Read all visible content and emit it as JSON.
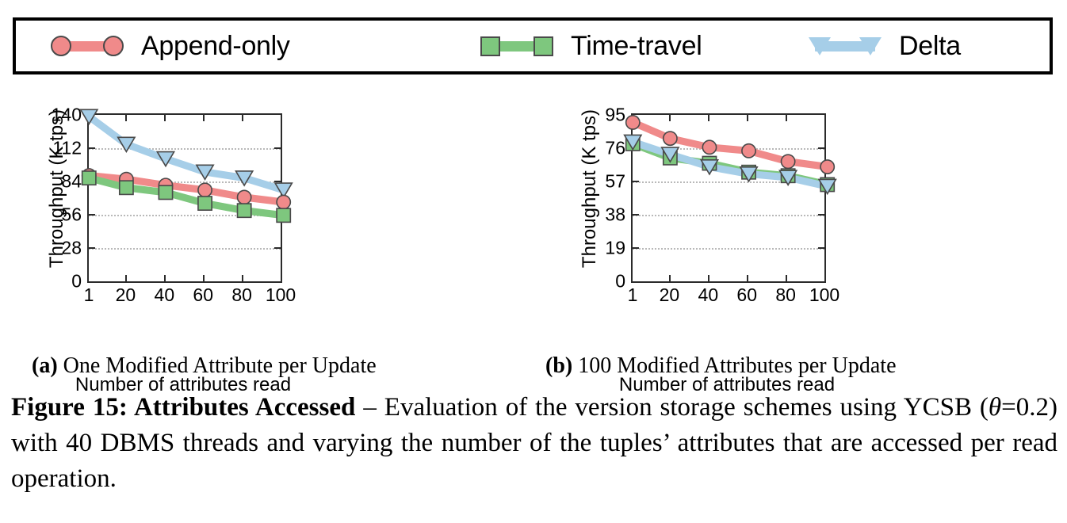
{
  "legend": {
    "entries": [
      {
        "label": "Append-only",
        "marker": "circle",
        "color": "#f08a8a",
        "icon": "circle-marker-icon"
      },
      {
        "label": "Time-travel",
        "marker": "square",
        "color": "#7ec77e",
        "icon": "square-marker-icon"
      },
      {
        "label": "Delta",
        "marker": "triangle-down",
        "color": "#a6cee8",
        "icon": "triangle-down-marker-icon"
      }
    ]
  },
  "subcaptions": {
    "a_tag": "(a)",
    "a_text": " One Modified Attribute per Update",
    "b_tag": "(b)",
    "b_text": " 100 Modified Attributes per Update"
  },
  "caption": {
    "head": "Figure 15:  Attributes Accessed",
    "dash": " – Evaluation of the version storage schemes using YCSB (",
    "theta": "θ",
    "theta_val": "=0.2) with 40 DBMS threads and varying the number of the tuples’ attributes that are accessed per read operation."
  },
  "chart_data": [
    {
      "type": "line",
      "panel": "a",
      "title": "(a) One Modified Attribute per Update",
      "xlabel": "Number of attributes read",
      "ylabel": "Throughput (K tps)",
      "x": [
        1,
        20,
        40,
        60,
        80,
        100
      ],
      "xticklabels": [
        "1",
        "20",
        "40",
        "60",
        "80",
        "100"
      ],
      "yticks": [
        0,
        28,
        56,
        84,
        112,
        140
      ],
      "yticklabels": [
        "0",
        "28",
        "56",
        "84",
        "112",
        "140"
      ],
      "xlim": [
        1,
        100
      ],
      "ylim": [
        0,
        140
      ],
      "grid": true,
      "legend_position": "above-figure",
      "series": [
        {
          "name": "Append-only",
          "color": "#f08a8a",
          "marker": "circle",
          "values": [
            90,
            87,
            82,
            78,
            72,
            68
          ]
        },
        {
          "name": "Time-travel",
          "color": "#7ec77e",
          "marker": "square",
          "values": [
            88,
            80,
            76,
            67,
            61,
            57
          ]
        },
        {
          "name": "Delta",
          "color": "#a6cee8",
          "marker": "triangle-down",
          "values": [
            139,
            116,
            104,
            93,
            88,
            78
          ]
        }
      ]
    },
    {
      "type": "line",
      "panel": "b",
      "title": "(b) 100 Modified Attributes per Update",
      "xlabel": "Number of attributes read",
      "ylabel": "Throughput (K tps)",
      "x": [
        1,
        20,
        40,
        60,
        80,
        100
      ],
      "xticklabels": [
        "1",
        "20",
        "40",
        "60",
        "80",
        "100"
      ],
      "yticks": [
        0,
        19,
        38,
        57,
        76,
        95
      ],
      "yticklabels": [
        "0",
        "19",
        "38",
        "57",
        "76",
        "95"
      ],
      "xlim": [
        1,
        100
      ],
      "ylim": [
        0,
        95
      ],
      "grid": true,
      "legend_position": "above-figure",
      "series": [
        {
          "name": "Append-only",
          "color": "#f08a8a",
          "marker": "circle",
          "values": [
            91,
            82,
            77,
            75,
            69,
            66
          ]
        },
        {
          "name": "Time-travel",
          "color": "#7ec77e",
          "marker": "square",
          "values": [
            79,
            71,
            68,
            63,
            61,
            56
          ]
        },
        {
          "name": "Delta",
          "color": "#a6cee8",
          "marker": "triangle-down",
          "values": [
            80,
            73,
            66,
            62,
            60,
            55
          ]
        }
      ]
    }
  ]
}
